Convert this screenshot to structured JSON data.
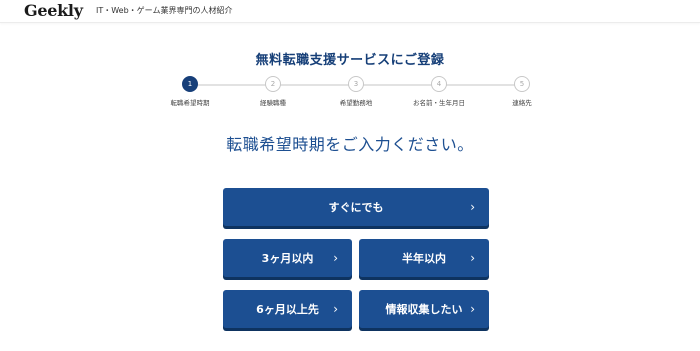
{
  "header": {
    "logo": "Geekly",
    "tagline": "IT・Web・ゲーム業界専門の人材紹介"
  },
  "form": {
    "title": "無料転職支援サービスにご登録",
    "question": "転職希望時期をご入力ください。",
    "steps": [
      {
        "number": "1",
        "label": "転職希望時期",
        "active": true
      },
      {
        "number": "2",
        "label": "経験職種",
        "active": false
      },
      {
        "number": "3",
        "label": "希望勤務地",
        "active": false
      },
      {
        "number": "4",
        "label": "お名前・生年月日",
        "active": false
      },
      {
        "number": "5",
        "label": "連絡先",
        "active": false
      }
    ],
    "options": {
      "asap": "すぐにでも",
      "within_3_months": "3ヶ月以内",
      "within_6_months": "半年以内",
      "after_6_months": "6ヶ月以上先",
      "info_gathering": "情報収集したい"
    },
    "chevron": "›"
  },
  "colors": {
    "primary": "#1c4f92",
    "title": "#163f78",
    "active_step": "#173f79"
  }
}
